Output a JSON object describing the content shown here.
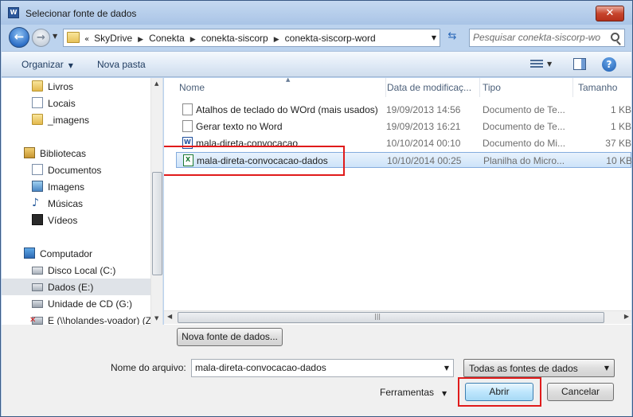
{
  "window": {
    "title": "Selecionar fonte de dados",
    "app_icon_letter": "W",
    "close_glyph": "✕"
  },
  "address": {
    "lead": "«",
    "path": [
      "SkyDrive",
      "Conekta",
      "conekta-siscorp",
      "conekta-siscorp-word"
    ],
    "search_placeholder": "Pesquisar conekta-siscorp-word"
  },
  "commandbar": {
    "organize_label": "Organizar",
    "new_folder_label": "Nova pasta"
  },
  "navpane": {
    "items": [
      {
        "label": "Livros",
        "icon": "folder-icon"
      },
      {
        "label": "Locais",
        "icon": "places-icon"
      },
      {
        "label": "_imagens",
        "icon": "folder-icon"
      },
      {
        "label": "Bibliotecas",
        "icon": "libraries-icon"
      },
      {
        "label": "Documentos",
        "icon": "documents-icon"
      },
      {
        "label": "Imagens",
        "icon": "pictures-icon"
      },
      {
        "label": "Músicas",
        "icon": "music-icon"
      },
      {
        "label": "Vídeos",
        "icon": "videos-icon"
      },
      {
        "label": "Computador",
        "icon": "computer-icon"
      },
      {
        "label": "Disco Local (C:)",
        "icon": "drive-icon"
      },
      {
        "label": "Dados (E:)",
        "icon": "drive-icon",
        "selected": true
      },
      {
        "label": "Unidade de CD (G:)",
        "icon": "cd-drive-icon"
      },
      {
        "label": "E (\\\\holandes-voador) (Z",
        "icon": "network-drive-icon"
      }
    ]
  },
  "filelist": {
    "columns": [
      "Nome",
      "Data de modificaç...",
      "Tipo",
      "Tamanho"
    ],
    "rows": [
      {
        "name": "Atalhos de teclado do WOrd (mais usados)",
        "date": "19/09/2013 14:56",
        "type": "Documento de Te...",
        "size": "1 KB",
        "icon": "text-document-icon"
      },
      {
        "name": "Gerar texto no Word",
        "date": "19/09/2013 16:21",
        "type": "Documento de Te...",
        "size": "1 KB",
        "icon": "text-document-icon"
      },
      {
        "name": "mala-direta-convocacao",
        "date": "10/10/2014 00:10",
        "type": "Documento do Mi...",
        "size": "37 KB",
        "icon": "word-document-icon"
      },
      {
        "name": "mala-direta-convocacao-dados",
        "date": "10/10/2014 00:25",
        "type": "Planilha do Micro...",
        "size": "10 KB",
        "icon": "excel-spreadsheet-icon",
        "selected": true
      }
    ]
  },
  "bottom": {
    "new_source_label": "Nova fonte de dados...",
    "filename_label": "Nome do arquivo:",
    "filename_value": "mala-direta-convocacao-dados",
    "filetype_value": "Todas as fontes de dados",
    "tools_label": "Ferramentas",
    "open_label": "Abrir",
    "cancel_label": "Cancelar"
  },
  "colors": {
    "highlight_box": "#e01b1b",
    "selection": "#cde3f9"
  }
}
